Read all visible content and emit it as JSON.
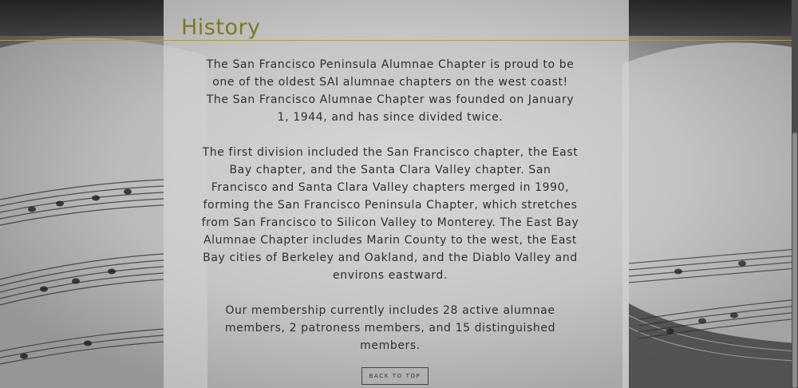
{
  "section": {
    "heading": "History",
    "paragraphs": [
      "The San Francisco Peninsula Alumnae Chapter is proud to be one of the oldest SAI alumnae chapters on the west coast! The San Francisco Alumnae Chapter was founded on January 1, 1944, and has since divided twice.",
      "The first division included the San Francisco chapter, the East Bay chapter, and the Santa Clara Valley chapter. San Francisco and Santa Clara Valley chapters merged in 1990, forming the San Francisco Peninsula Chapter, which stretches from San Francisco to Silicon Valley to Monterey. The East Bay Alumnae Chapter includes Marin County to the west, the East Bay cities of Berkeley and Oakland, and the Diablo Valley and environs eastward.",
      "Our membership currently includes 28 active alumnae members, 2 patroness members, and 15 distinguished members."
    ]
  },
  "back_to_top_label": "BACK TO TOP",
  "colors": {
    "heading": "#7e7a1f",
    "rule": "#b09a38",
    "text": "#2f2f2f"
  }
}
